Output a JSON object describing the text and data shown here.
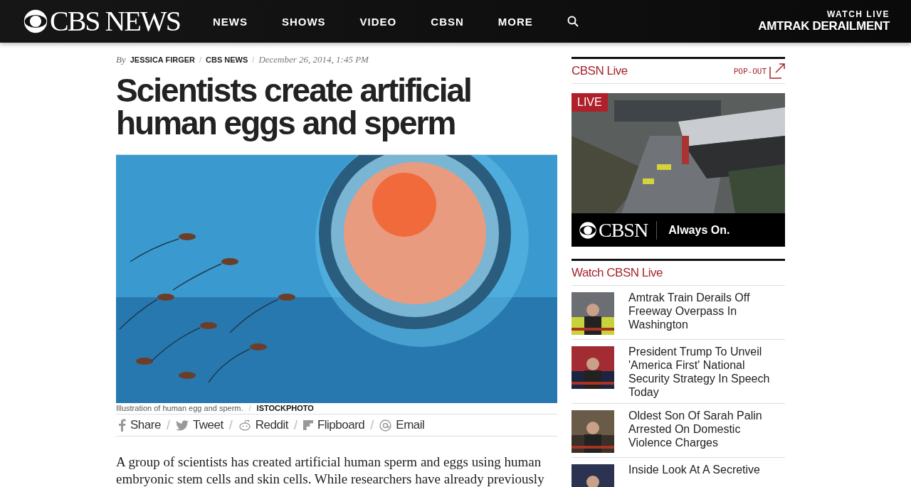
{
  "header": {
    "logo": "CBS NEWS",
    "nav": [
      {
        "label": "NEWS"
      },
      {
        "label": "SHOWS"
      },
      {
        "label": "VIDEO"
      },
      {
        "label": "CBSN"
      },
      {
        "label": "MORE"
      }
    ],
    "watch_live": "WATCH LIVE",
    "live_story": "AMTRAK DERAILMENT"
  },
  "article": {
    "by": "By",
    "author": "JESSICA FIRGER",
    "author_separator": "/",
    "source": "CBS NEWS",
    "source_separator": "/",
    "date": "December 26, 2014, 1:45 PM",
    "title": "Scientists create artificial human eggs and sperm",
    "caption": "Illustration of human egg and sperm.",
    "caption_separator": "/",
    "credit": "ISTOCKPHOTO",
    "share": [
      {
        "kind": "facebook",
        "label": "Share"
      },
      {
        "kind": "twitter",
        "separator": "/",
        "label": "Tweet"
      },
      {
        "kind": "reddit",
        "separator": "/",
        "label": "Reddit"
      },
      {
        "kind": "flipboard",
        "separator": "/",
        "label": "Flipboard"
      },
      {
        "kind": "email",
        "separator": "/",
        "label": "Email"
      }
    ],
    "body": "A group of scientists has created artificial human sperm and eggs using human embryonic stem cells and skin cells. While researchers have already previously"
  },
  "sidebar": {
    "live_title": "CBSN Live",
    "popout": "POP-OUT",
    "live_badge": "LIVE",
    "player_logo": "CBSN",
    "player_tagline": "Always On.",
    "watch_title": "Watch CBSN Live",
    "videos": [
      {
        "title": "Amtrak Train Derails Off Freeway Overpass In Washington"
      },
      {
        "title": "President Trump To Unveil 'America First' National Security Strategy In Speech Today"
      },
      {
        "title": "Oldest Son Of Sarah Palin Arrested On Domestic Violence Charges"
      },
      {
        "title": "Inside Look At A Secretive"
      }
    ]
  }
}
